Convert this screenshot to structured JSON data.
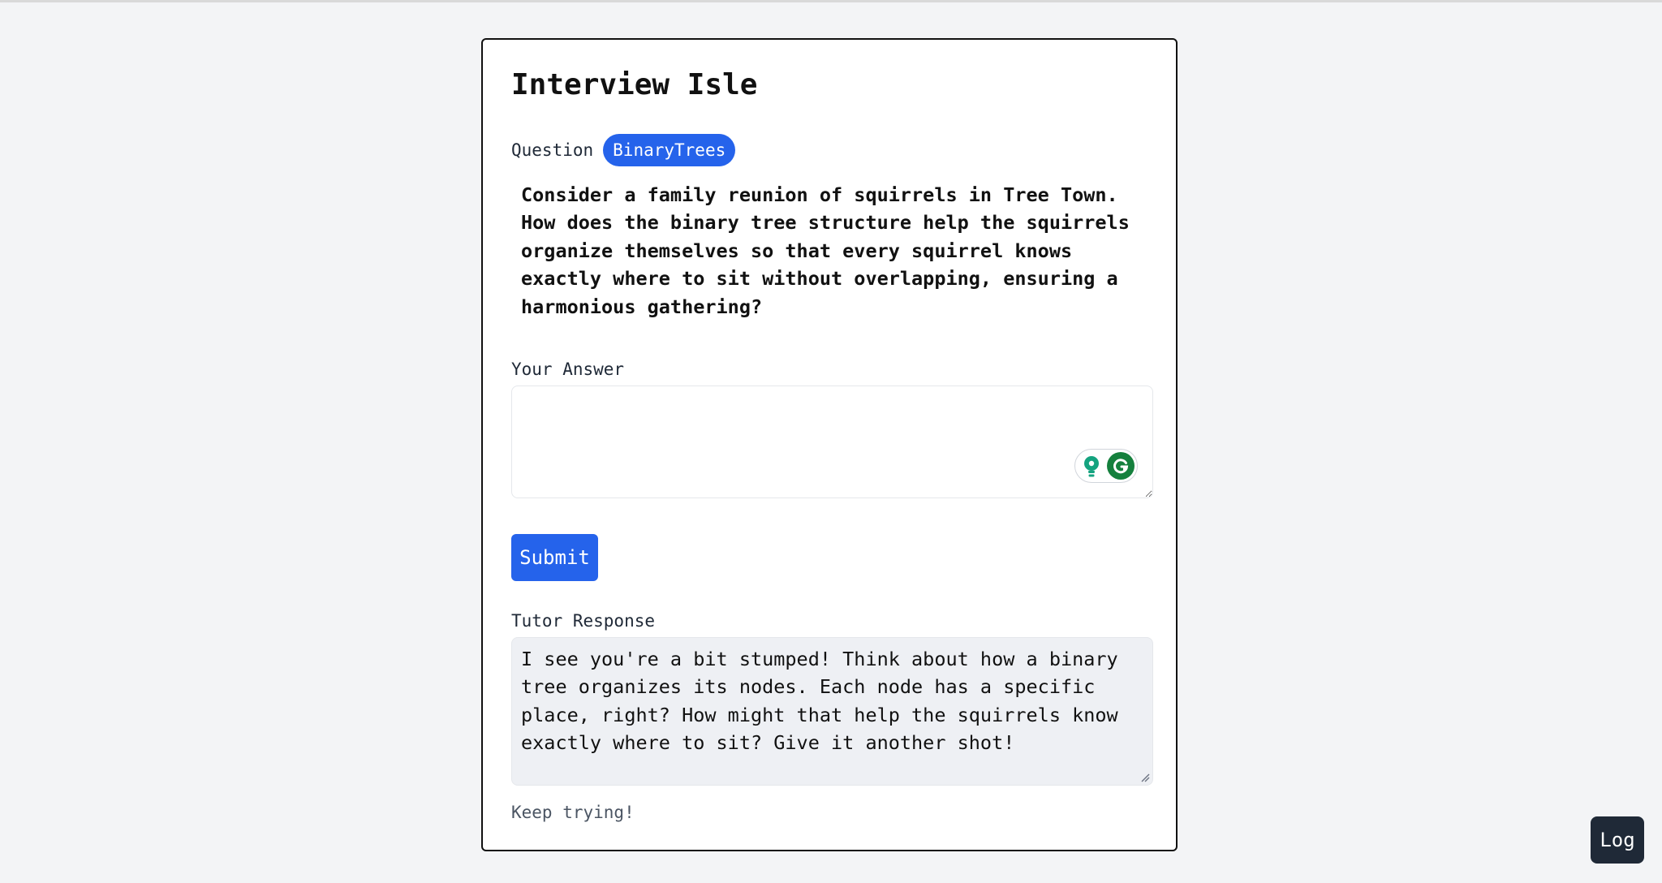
{
  "app": {
    "title": "Interview Isle"
  },
  "question": {
    "label": "Question",
    "topic_badge": "BinaryTrees",
    "text": "Consider a family reunion of squirrels in Tree Town. How does the binary tree structure help the squirrels organize themselves so that every squirrel knows exactly where to sit without overlapping, ensuring a harmonious gathering?"
  },
  "answer": {
    "label": "Your Answer",
    "value": "",
    "placeholder": ""
  },
  "grammarly": {
    "icons": [
      "lightbulb-icon",
      "grammarly-g-icon"
    ]
  },
  "actions": {
    "submit_label": "Submit",
    "log_label": "Log"
  },
  "tutor": {
    "label": "Tutor Response",
    "text": "I see you're a bit stumped! Think about how a binary tree organizes its nodes. Each node has a specific place, right? How might that help the squirrels know exactly where to sit? Give it another shot!"
  },
  "status": {
    "message": "Keep trying!"
  },
  "colors": {
    "accent": "#2563eb",
    "background": "#f3f4f6",
    "card": "#ffffff",
    "tutor_bg": "#eef0f4",
    "log_button": "#1f2937",
    "grammarly": "#15803d"
  }
}
